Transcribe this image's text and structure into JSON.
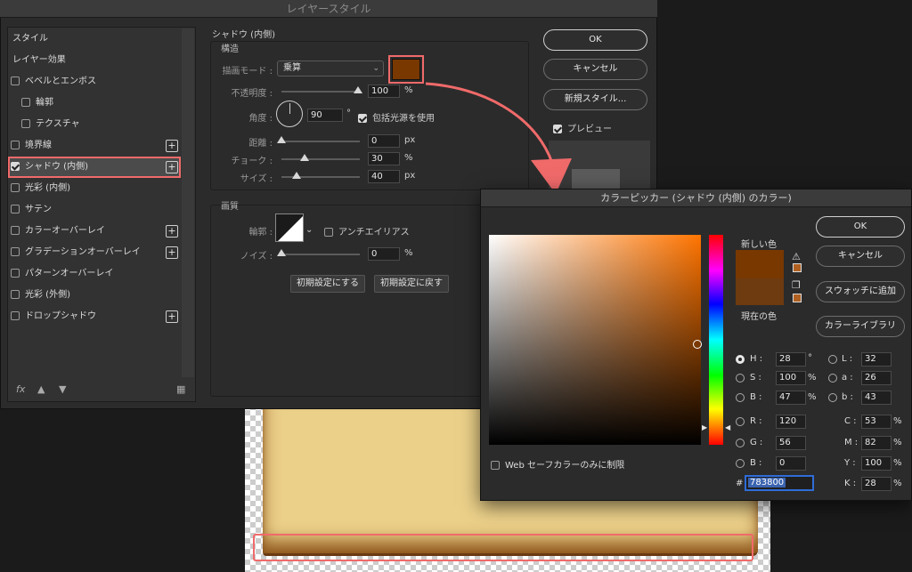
{
  "layer_style": {
    "title": "レイヤースタイル",
    "left_items": [
      {
        "label": "スタイル"
      },
      {
        "label": "レイヤー効果"
      },
      {
        "label": "ベベルとエンボス"
      },
      {
        "label": "輪郭"
      },
      {
        "label": "テクスチャ"
      },
      {
        "label": "境界線"
      },
      {
        "label": "シャドウ (内側)"
      },
      {
        "label": "光彩 (内側)"
      },
      {
        "label": "サテン"
      },
      {
        "label": "カラーオーバーレイ"
      },
      {
        "label": "グラデーションオーバーレイ"
      },
      {
        "label": "パターンオーバーレイ"
      },
      {
        "label": "光彩 (外側)"
      },
      {
        "label": "ドロップシャドウ"
      }
    ],
    "fx_label": "fx",
    "section_title": "シャドウ (内側)",
    "structure_label": "構造",
    "blend_mode_label": "描画モード :",
    "blend_mode_value": "乗算",
    "shadow_color": "#783800",
    "opacity_label": "不透明度 :",
    "opacity_value": "100",
    "angle_label": "角度 :",
    "angle_value": "90",
    "degree_unit": "°",
    "global_light_label": "包括光源を使用",
    "distance_label": "距離 :",
    "distance_value": "0",
    "choke_label": "チョーク :",
    "choke_value": "30",
    "size_label": "サイズ :",
    "size_value": "40",
    "unit_px": "px",
    "unit_percent": "%",
    "quality_label": "画質",
    "contour_label": "輪郭 :",
    "antialias_label": "アンチエイリアス",
    "noise_label": "ノイズ :",
    "noise_value": "0",
    "make_default": "初期設定にする",
    "reset_default": "初期設定に戻す",
    "ok": "OK",
    "cancel": "キャンセル",
    "new_style": "新規スタイル...",
    "preview_label": "プレビュー"
  },
  "picker": {
    "title": "カラーピッカー (シャドウ (内側) のカラー)",
    "ok": "OK",
    "cancel": "キャンセル",
    "add_swatch": "スウォッチに追加",
    "color_library": "カラーライブラリ",
    "new_label": "新しい色",
    "current_label": "現在の色",
    "new_color": "#783800",
    "current_color": "#6e3a10",
    "web_safe_label": "Web セーフカラーのみに制限",
    "H": "28",
    "S": "100",
    "B": "47",
    "R": "120",
    "G": "56",
    "Bb": "0",
    "L": "32",
    "a": "26",
    "b": "43",
    "C": "53",
    "M": "82",
    "Y": "100",
    "K": "28",
    "hex": "783800",
    "labels": {
      "H": "H :",
      "S": "S :",
      "B": "B :",
      "R": "R :",
      "G": "G :",
      "Bb": "B :",
      "L": "L :",
      "a": "a :",
      "b": "b :",
      "C": "C :",
      "M": "M :",
      "Y": "Y :",
      "K": "K :",
      "hash": "#"
    },
    "units": {
      "deg": "°",
      "pct": "%"
    }
  }
}
